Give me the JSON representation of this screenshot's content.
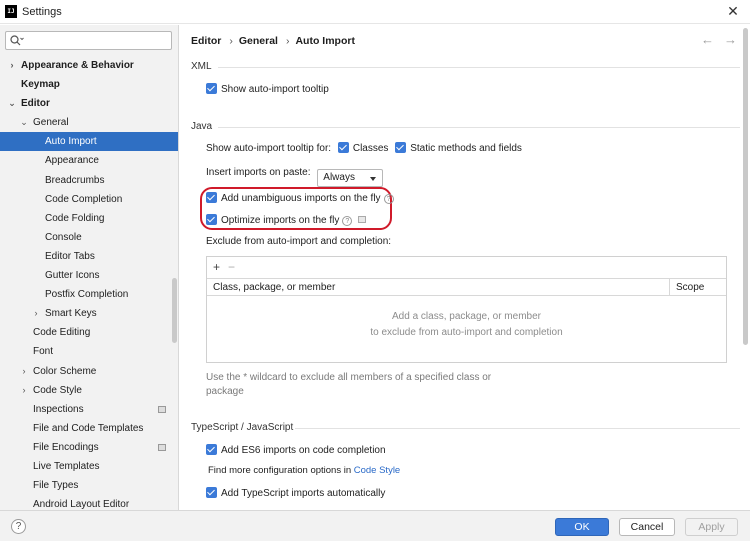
{
  "window": {
    "icon_text": "IJ",
    "title": "Settings",
    "close_symbol": "✕"
  },
  "search": {
    "value": "",
    "placeholder": ""
  },
  "sidebar": {
    "items": [
      {
        "label": "Appearance & Behavior",
        "arrow": "›",
        "bold": true
      },
      {
        "label": "Keymap",
        "arrow": "",
        "bold": true
      },
      {
        "label": "Editor",
        "arrow": "⌄",
        "bold": true
      },
      {
        "label": "General",
        "arrow": "⌄",
        "bold": false
      },
      {
        "label": "Auto Import",
        "arrow": "",
        "bold": false,
        "selected": true
      },
      {
        "label": "Appearance",
        "arrow": "",
        "bold": false
      },
      {
        "label": "Breadcrumbs",
        "arrow": "",
        "bold": false
      },
      {
        "label": "Code Completion",
        "arrow": "",
        "bold": false
      },
      {
        "label": "Code Folding",
        "arrow": "",
        "bold": false
      },
      {
        "label": "Console",
        "arrow": "",
        "bold": false
      },
      {
        "label": "Editor Tabs",
        "arrow": "",
        "bold": false
      },
      {
        "label": "Gutter Icons",
        "arrow": "",
        "bold": false
      },
      {
        "label": "Postfix Completion",
        "arrow": "",
        "bold": false
      },
      {
        "label": "Smart Keys",
        "arrow": "›",
        "bold": false
      },
      {
        "label": "Code Editing",
        "arrow": "",
        "bold": false
      },
      {
        "label": "Font",
        "arrow": "",
        "bold": false
      },
      {
        "label": "Color Scheme",
        "arrow": "›",
        "bold": false
      },
      {
        "label": "Code Style",
        "arrow": "›",
        "bold": false
      },
      {
        "label": "Inspections",
        "arrow": "",
        "bold": false
      },
      {
        "label": "File and Code Templates",
        "arrow": "",
        "bold": false
      },
      {
        "label": "File Encodings",
        "arrow": "",
        "bold": false
      },
      {
        "label": "Live Templates",
        "arrow": "",
        "bold": false
      },
      {
        "label": "File Types",
        "arrow": "",
        "bold": false
      },
      {
        "label": "Android Layout Editor",
        "arrow": "",
        "bold": false
      }
    ]
  },
  "breadcrumb": {
    "part1": "Editor",
    "part2": "General",
    "part3": "Auto Import",
    "sep": "›"
  },
  "nav": {
    "back": "←",
    "forward": "→"
  },
  "xml": {
    "title": "XML",
    "show_tooltip": {
      "label": "Show auto-import tooltip",
      "checked": true
    }
  },
  "java": {
    "title": "Java",
    "tooltip_for_label": "Show auto-import tooltip for:",
    "classes": {
      "label": "Classes",
      "checked": true
    },
    "static_methods": {
      "label": "Static methods and fields",
      "checked": true
    },
    "insert_on_paste_label": "Insert imports on paste:",
    "insert_on_paste_value": "Always",
    "add_unambiguous": {
      "label": "Add unambiguous imports on the fly",
      "checked": true
    },
    "optimize": {
      "label": "Optimize imports on the fly",
      "checked": true
    },
    "exclude_label": "Exclude from auto-import and completion:",
    "table": {
      "add": "+",
      "remove": "−",
      "columns": [
        "Class, package, or member",
        "Scope"
      ],
      "empty_line1": "Add a class, package, or member",
      "empty_line2": "to exclude from auto-import and completion"
    },
    "hint_line1": "Use the * wildcard to exclude all members of a specified class or",
    "hint_line2": "package"
  },
  "typescript": {
    "title": "TypeScript / JavaScript",
    "es6": {
      "label": "Add ES6 imports on code completion",
      "checked": true
    },
    "more_options_text": "Find more configuration options in",
    "more_options_link": "Code Style",
    "ts_auto": {
      "label": "Add TypeScript imports automatically",
      "checked": true
    }
  },
  "footer": {
    "help": "?",
    "ok": "OK",
    "cancel": "Cancel",
    "apply": "Apply"
  },
  "colors": {
    "accent": "#3b7ad8",
    "selection": "#2f6fc3",
    "highlight": "#d01a2a",
    "link": "#2a6ac8"
  }
}
